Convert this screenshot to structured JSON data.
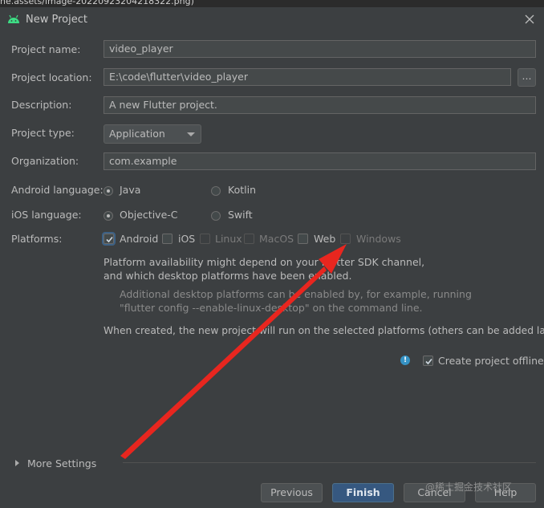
{
  "browser_strip": "ne.assets/image-20220923204218322.png)",
  "window": {
    "title": "New Project"
  },
  "form": {
    "project_name": {
      "label": "Project name:",
      "value": "video_player"
    },
    "project_location": {
      "label": "Project location:",
      "value": "E:\\code\\flutter\\video_player",
      "browse": "..."
    },
    "description": {
      "label": "Description:",
      "value": "A new Flutter project."
    },
    "project_type": {
      "label": "Project type:",
      "value": "Application"
    },
    "organization": {
      "label": "Organization:",
      "value": "com.example"
    },
    "android_language": {
      "label": "Android language:",
      "options": [
        {
          "label": "Java",
          "selected": true
        },
        {
          "label": "Kotlin",
          "selected": false
        }
      ]
    },
    "ios_language": {
      "label": "iOS language:",
      "options": [
        {
          "label": "Objective-C",
          "selected": true
        },
        {
          "label": "Swift",
          "selected": false
        }
      ]
    },
    "platforms": {
      "label": "Platforms:",
      "items": [
        {
          "label": "Android",
          "checked": true
        },
        {
          "label": "iOS",
          "checked": false
        },
        {
          "label": "Linux",
          "checked": false
        },
        {
          "label": "MacOS",
          "checked": false
        },
        {
          "label": "Web",
          "checked": false
        },
        {
          "label": "Windows",
          "checked": false
        }
      ]
    }
  },
  "info": {
    "line1": "Platform availability might depend on your Flutter SDK channel,",
    "line2": "and which desktop platforms have been enabled.",
    "note1": "Additional desktop platforms can be enabled by, for example, running",
    "note2": "\"flutter config --enable-linux-desktop\" on the command line.",
    "line3": "When created, the new project will run on the selected platforms (others can be added later)."
  },
  "offline": {
    "label": "Create project offline",
    "checked": true
  },
  "more_settings": "More Settings",
  "buttons": {
    "previous": "Previous",
    "finish": "Finish",
    "cancel": "Cancel",
    "help": "Help"
  },
  "watermark": "@稀土掘金技术社区",
  "colors": {
    "accent": "#365880",
    "arrow": "#e8261f",
    "info": "#3592c4"
  }
}
